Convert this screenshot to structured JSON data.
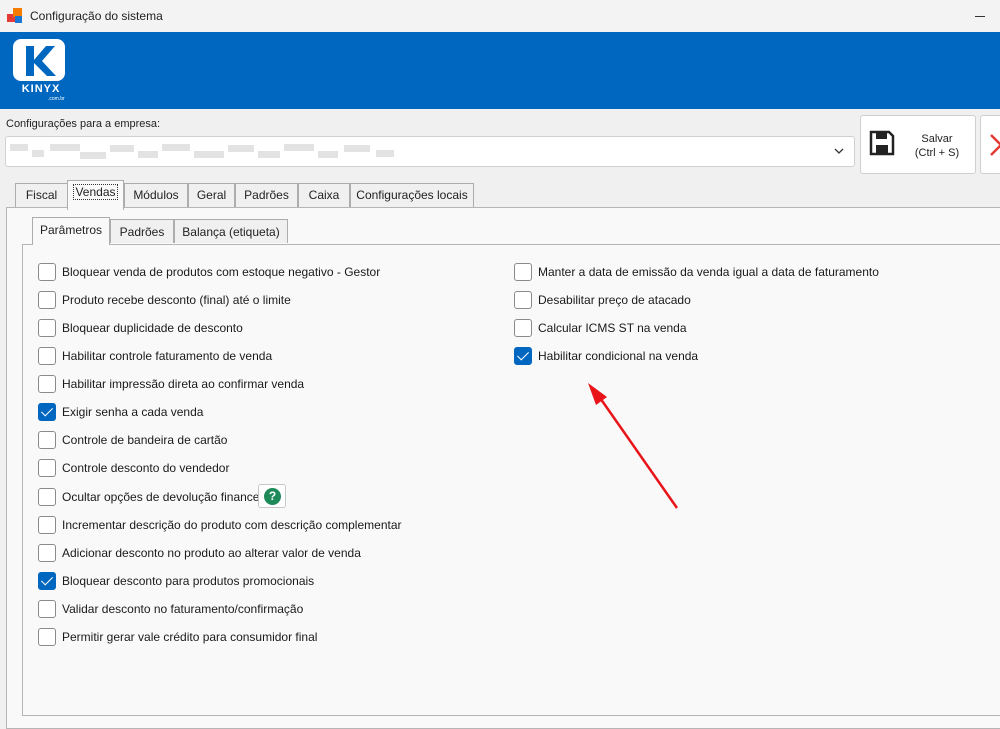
{
  "window": {
    "title": "Configuração do sistema"
  },
  "brand": {
    "name": "KINYX",
    "domain": ".com.br",
    "color": "#0067c0"
  },
  "company": {
    "label": "Configurações para a empresa:",
    "value": ""
  },
  "toolbar": {
    "save_label": "Salvar",
    "save_shortcut": "(Ctrl + S)"
  },
  "tabs": [
    "Fiscal",
    "Vendas",
    "Módulos",
    "Geral",
    "Padrões",
    "Caixa",
    "Configurações locais"
  ],
  "active_tab": "Vendas",
  "subtabs": [
    "Parâmetros",
    "Padrões",
    "Balança (etiqueta)"
  ],
  "active_subtab": "Parâmetros",
  "options_left": [
    {
      "label": "Bloquear venda de produtos com estoque negativo - Gestor",
      "checked": false
    },
    {
      "label": "Produto recebe desconto (final) até o limite",
      "checked": false
    },
    {
      "label": "Bloquear duplicidade de desconto",
      "checked": false
    },
    {
      "label": "Habilitar controle faturamento de venda",
      "checked": false
    },
    {
      "label": "Habilitar impressão direta ao confirmar venda",
      "checked": false
    },
    {
      "label": "Exigir senha a cada venda",
      "checked": true
    },
    {
      "label": "Controle de bandeira de cartão",
      "checked": false
    },
    {
      "label": "Controle desconto do vendedor",
      "checked": false
    },
    {
      "label": "Ocultar opções de devolução financeira",
      "checked": false
    },
    {
      "label": "Incrementar descrição do produto com descrição complementar",
      "checked": false
    },
    {
      "label": "Adicionar desconto no produto ao alterar valor de venda",
      "checked": false
    },
    {
      "label": "Bloquear desconto para produtos promocionais",
      "checked": true
    },
    {
      "label": "Validar desconto no faturamento/confirmação",
      "checked": false
    },
    {
      "label": "Permitir gerar vale crédito para consumidor final",
      "checked": false
    }
  ],
  "options_right": [
    {
      "label": "Manter a data de emissão da venda igual a data de faturamento",
      "checked": false
    },
    {
      "label": "Desabilitar preço de atacado",
      "checked": false
    },
    {
      "label": "Calcular ICMS ST na venda",
      "checked": false
    },
    {
      "label": "Habilitar condicional na venda",
      "checked": true
    }
  ],
  "help": {
    "glyph": "?"
  },
  "icons": {
    "app": "app-icon",
    "minimize": "minimize-icon",
    "dropdown": "chevron-down-icon",
    "save": "floppy-disk-icon",
    "close": "close-icon",
    "help": "help-icon",
    "annotation": "red-arrow-icon"
  },
  "colors": {
    "accent": "#0067c0",
    "help": "#1e8a5a",
    "annotation": "#e8141a",
    "close": "#e53935"
  }
}
